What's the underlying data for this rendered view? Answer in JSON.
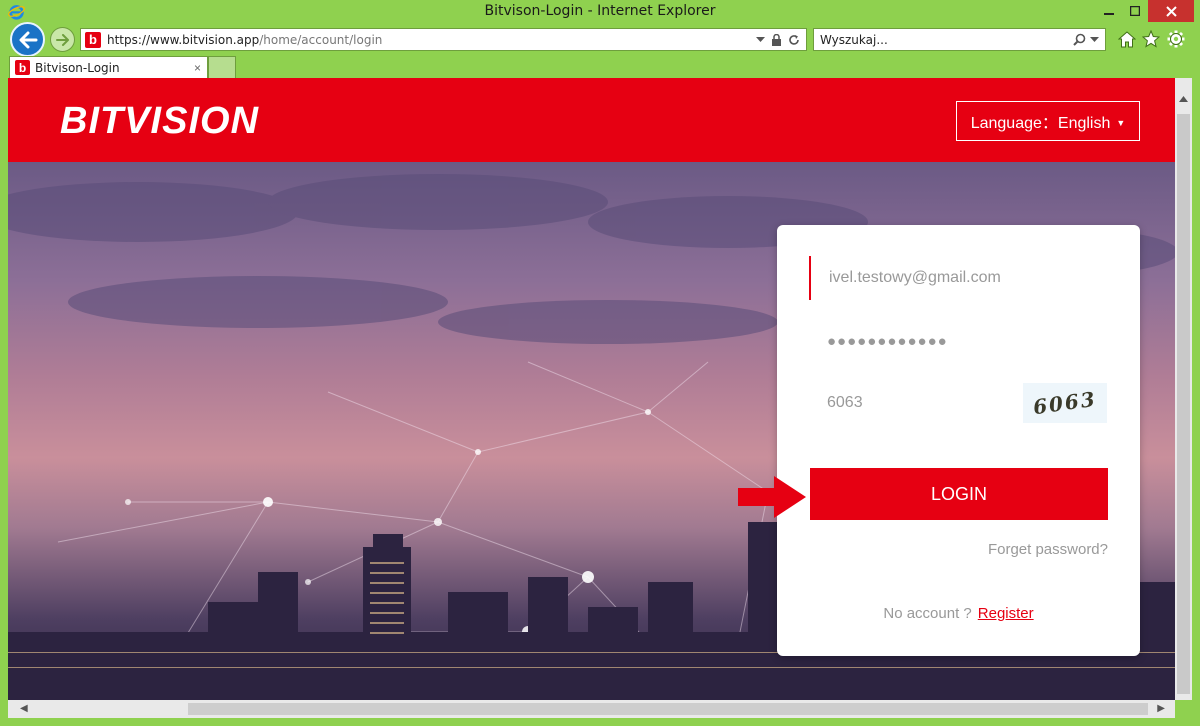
{
  "window": {
    "title": "Bitvison-Login - Internet Explorer"
  },
  "browser": {
    "url_host": "https://www.bitvision.app",
    "url_path": "/home/account/login",
    "search_placeholder": "Wyszukaj...",
    "tab_title": "Bitvison-Login",
    "tab_close": "×"
  },
  "header": {
    "logo": "BITVISION",
    "language_label": "Language：English"
  },
  "login": {
    "email_value": "ivel.testowy@gmail.com",
    "password_value": "●●●●●●●●●●●●",
    "captcha_value": "6063",
    "captcha_image_text": "6063",
    "login_button": "LOGIN",
    "forget_password": "Forget password?",
    "no_account": "No account ?",
    "register": "Register"
  },
  "colors": {
    "brand_red": "#e60012",
    "ie_frame_green": "#8fd14f"
  }
}
